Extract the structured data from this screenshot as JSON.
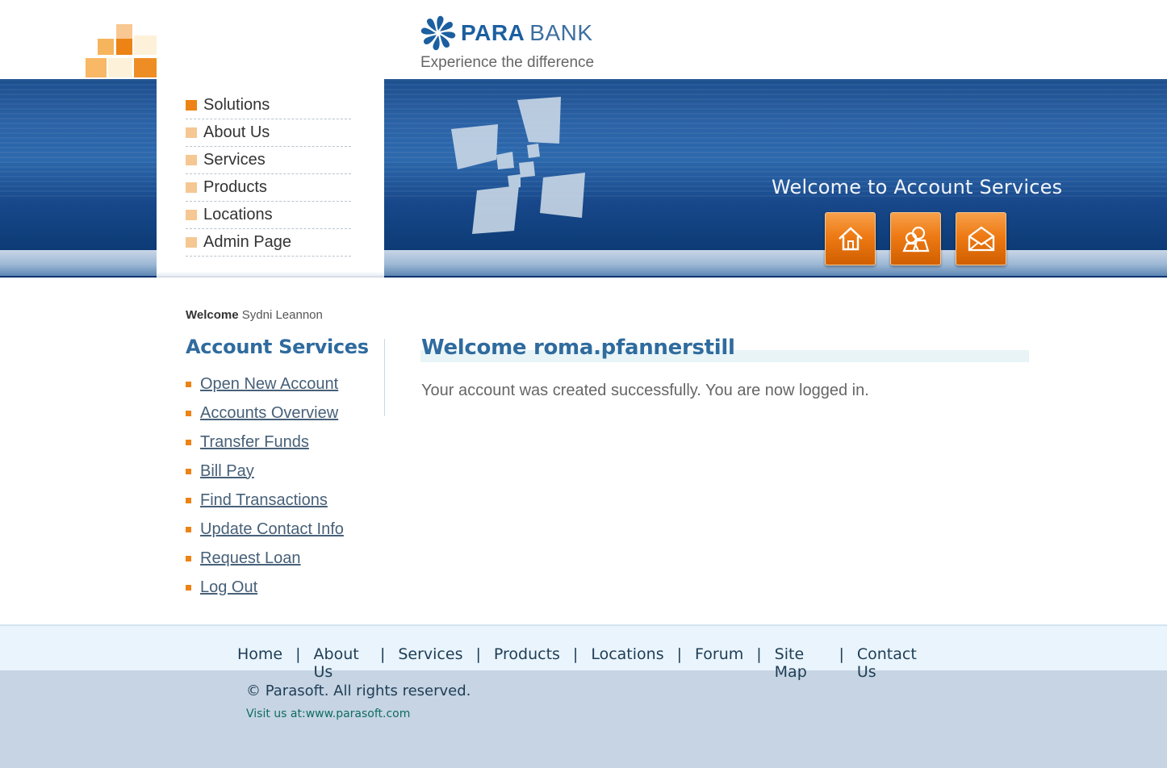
{
  "brand": {
    "name_part1": "PARA",
    "name_part2": "BANK",
    "tagline": "Experience the difference"
  },
  "banner": {
    "welcome_text": "Welcome to Account Services",
    "buttons": [
      {
        "icon": "home-icon"
      },
      {
        "icon": "about-icon"
      },
      {
        "icon": "contact-envelope-icon"
      }
    ]
  },
  "top_menu": [
    {
      "label": "Solutions"
    },
    {
      "label": "About Us"
    },
    {
      "label": "Services"
    },
    {
      "label": "Products"
    },
    {
      "label": "Locations"
    },
    {
      "label": "Admin Page"
    }
  ],
  "sidebar": {
    "welcome_label": "Welcome",
    "user_name": "Sydni Leannon",
    "title": "Account Services",
    "links": [
      {
        "label": "Open New Account"
      },
      {
        "label": "Accounts Overview"
      },
      {
        "label": "Transfer Funds"
      },
      {
        "label": "Bill Pay"
      },
      {
        "label": "Find Transactions"
      },
      {
        "label": "Update Contact Info"
      },
      {
        "label": "Request Loan"
      },
      {
        "label": "Log Out"
      }
    ]
  },
  "main": {
    "title": "Welcome roma.pfannerstill",
    "message": "Your account was created successfully. You are now logged in."
  },
  "footer": {
    "nav": [
      "Home",
      "About Us",
      "Services",
      "Products",
      "Locations",
      "Forum",
      "Site Map",
      "Contact Us"
    ],
    "separator": "|",
    "copyright": "© Parasoft. All rights reserved.",
    "visit_label": "Visit us at:",
    "visit_link": "www.parasoft.com"
  },
  "colors": {
    "accent_orange": "#ec8314",
    "heading_blue": "#2f6b9e",
    "banner_blue": "#1d4f8e"
  }
}
